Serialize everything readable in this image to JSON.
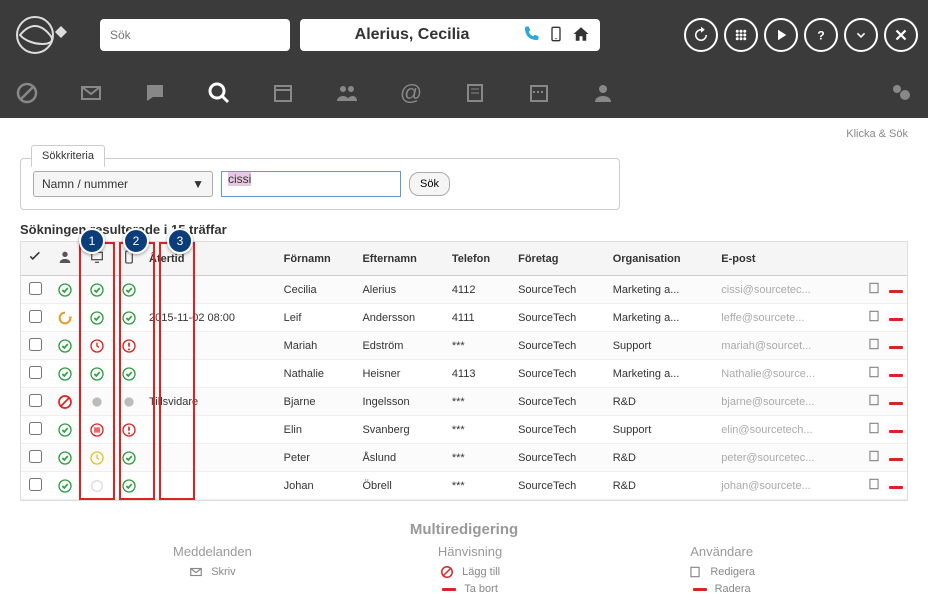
{
  "topbar": {
    "search_placeholder": "Sök",
    "contact_name": "Alerius, Cecilia"
  },
  "content": {
    "klicka_sok": "Klicka & Sök",
    "tab_label": "Sökkriteria",
    "criteria_select": "Namn / nummer",
    "criteria_value": "cissi",
    "sok_btn": "Sök",
    "results_title": "Sökningen resulterade i 15 träffar"
  },
  "table": {
    "headers": {
      "atertid": "Återtid",
      "fornamn": "Förnamn",
      "efternamn": "Efternamn",
      "telefon": "Telefon",
      "foretag": "Företag",
      "organisation": "Organisation",
      "epost": "E-post"
    },
    "rows": [
      {
        "s1": "check",
        "s2": "check",
        "s3": "check",
        "atertid": "",
        "fornamn": "Cecilia",
        "efternamn": "Alerius",
        "telefon": "4112",
        "foretag": "SourceTech",
        "org": "Marketing a...",
        "epost": "cissi@sourcetec..."
      },
      {
        "s1": "away",
        "s2": "check",
        "s3": "check",
        "atertid": "2015-11-02 08:00",
        "fornamn": "Leif",
        "efternamn": "Andersson",
        "telefon": "4111",
        "foretag": "SourceTech",
        "org": "Marketing a...",
        "epost": "leffe@sourcete..."
      },
      {
        "s1": "check",
        "s2": "clock",
        "s3": "warn",
        "atertid": "",
        "fornamn": "Mariah",
        "efternamn": "Edström",
        "telefon": "***",
        "foretag": "SourceTech",
        "org": "Support",
        "epost": "mariah@sourcet..."
      },
      {
        "s1": "check",
        "s2": "check",
        "s3": "check",
        "atertid": "",
        "fornamn": "Nathalie",
        "efternamn": "Heisner",
        "telefon": "4113",
        "foretag": "SourceTech",
        "org": "Marketing a...",
        "epost": "Nathalie@source..."
      },
      {
        "s1": "block",
        "s2": "gray",
        "s3": "gray",
        "atertid": "Tillsvidare",
        "fornamn": "Bjarne",
        "efternamn": "Ingelsson",
        "telefon": "***",
        "foretag": "SourceTech",
        "org": "R&D",
        "epost": "bjarne@sourcete..."
      },
      {
        "s1": "check",
        "s2": "food",
        "s3": "warn",
        "atertid": "",
        "fornamn": "Elin",
        "efternamn": "Svanberg",
        "telefon": "***",
        "foretag": "SourceTech",
        "org": "Support",
        "epost": "elin@sourcetech..."
      },
      {
        "s1": "check",
        "s2": "clock-y",
        "s3": "check",
        "atertid": "",
        "fornamn": "Peter",
        "efternamn": "Åslund",
        "telefon": "***",
        "foretag": "SourceTech",
        "org": "R&D",
        "epost": "peter@sourcetec..."
      },
      {
        "s1": "check",
        "s2": "none",
        "s3": "check",
        "atertid": "",
        "fornamn": "Johan",
        "efternamn": "Öbrell",
        "telefon": "***",
        "foretag": "SourceTech",
        "org": "R&D",
        "epost": "johan@sourcete..."
      }
    ]
  },
  "markers": [
    "1",
    "2",
    "3"
  ],
  "multi": {
    "title": "Multiredigering",
    "col1": {
      "title": "Meddelanden",
      "skriv": "Skriv"
    },
    "col2": {
      "title": "Hänvisning",
      "lagg_till": "Lägg till",
      "ta_bort": "Ta bort"
    },
    "col3": {
      "title": "Användare",
      "redigera": "Redigera",
      "radera": "Radera"
    }
  }
}
